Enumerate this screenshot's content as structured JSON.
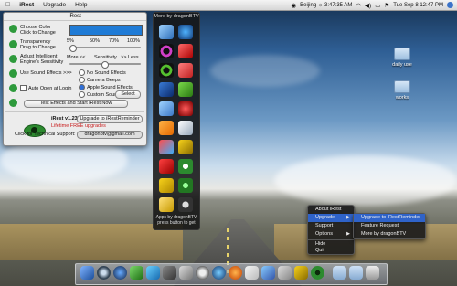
{
  "menubar": {
    "app_name": "iRest",
    "menus": [
      "Upgrade",
      "Help"
    ],
    "location_time": "Beijing ☼ 3:47:35 AM",
    "clock": "Tue Sep 8  12:47 PM"
  },
  "irest_panel": {
    "title": "iRest",
    "choose_color": "Choose Color\nClick to Change",
    "transparency": "Transparency\nDrag to Change",
    "transparency_ticks": [
      "5%",
      "50%",
      "70%",
      "100%"
    ],
    "sensitivity_label": "Adjust Intelligent\nEngine's Sensitivity",
    "sensitivity_more": "More <<",
    "sensitivity_mid": "Sensitivity",
    "sensitivity_less": ">> Less",
    "sound_label": "Use Sound Effects  >>>",
    "sound_options": [
      "No Sound Effects",
      "Camera Beeps",
      "Apple Sound Effects",
      "Custom Sound"
    ],
    "selected_sound": "Apple Sound Effects",
    "select_button": "Select",
    "auto_open": "Auto Open at Login",
    "test_button": "Test Effects and Start iRest Now",
    "version": "iRest v1.23",
    "upgrade_button": "Upgrade to iRestReminder",
    "lifetime": "Lifetime FREE upgrades",
    "support_label": "Click for Technical Support:",
    "support_email": "dragonbtv@gmail.com"
  },
  "dragon_panel": {
    "title": "More by dragonBTV",
    "footer": "Apps by dragonBTV\npress button to get"
  },
  "desktop": {
    "icons": [
      "daily use",
      "works"
    ]
  },
  "context_menu": {
    "items": [
      "About iRest",
      "Upgrade",
      "Support",
      "Options",
      "Hide",
      "Quit"
    ],
    "highlighted": "Upgrade"
  },
  "submenu": {
    "items": [
      "Upgrade to iRestReminder",
      "Feature Request",
      "More by dragonBTV"
    ],
    "highlighted": "Upgrade to iRestReminder"
  },
  "colors": {
    "accent": "#2f63c9",
    "green": "#2e9a3c",
    "link_red": "#c81d1d",
    "color_swatch": "#1f7bd6"
  }
}
